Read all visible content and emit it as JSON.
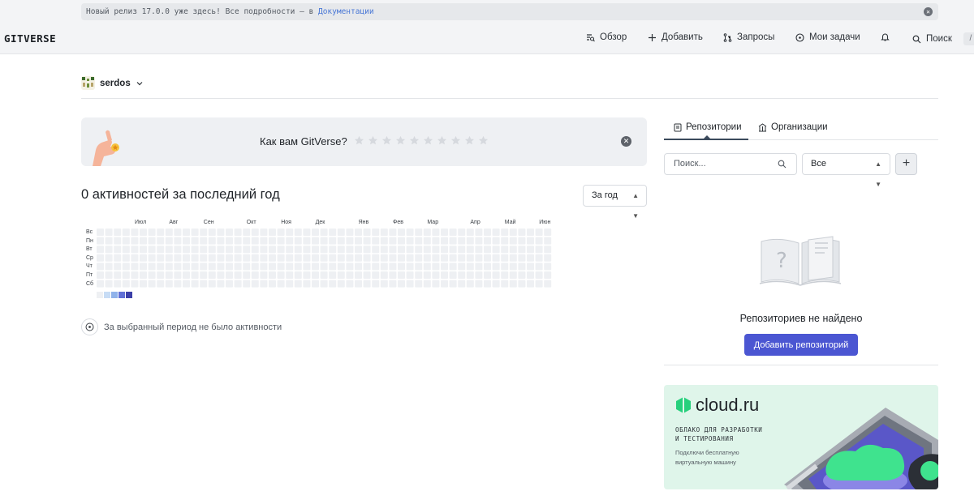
{
  "announcement": {
    "text": "Новый релиз 17.0.0 уже здесь! Все подробности — в ",
    "link": "Документации"
  },
  "header": {
    "logo": "GITVERSE",
    "nav": {
      "overview": "Обзор",
      "add": "Добавить",
      "requests": "Запросы",
      "tasks": "Мои задачи",
      "search": "Поиск",
      "search_shortcut": "/"
    }
  },
  "user": {
    "name": "serdos"
  },
  "feedback": {
    "question": "Как вам GitVerse?",
    "stars": 10
  },
  "activity": {
    "title": "0 активностей за последний год",
    "period": "За год",
    "months": [
      "Июл",
      "Авг",
      "Сен",
      "Окт",
      "Ноя",
      "Дек",
      "Янв",
      "Фев",
      "Мар",
      "Апр",
      "Май",
      "Июн"
    ],
    "days": [
      "Вс",
      "Пн",
      "Вт",
      "Ср",
      "Чт",
      "Пт",
      "Сб"
    ],
    "weeks": 53,
    "legend_colors": [
      "#eef0f3",
      "#c7dcf5",
      "#8fb2ea",
      "#5f6fd6",
      "#3b3fa8"
    ],
    "empty_text": "За выбранный период не было активности"
  },
  "repos": {
    "tabs": [
      "Репозитории",
      "Организации"
    ],
    "search_placeholder": "Поиск...",
    "filter_value": "Все",
    "add_icon": "+",
    "empty_title": "Репозиториев не найдено",
    "add_button": "Добавить репозиторий"
  },
  "ad": {
    "brand": "cloud.ru",
    "headline_1": "Облако для разработки",
    "headline_2": "и тестирования",
    "sub_1": "Подключи бесплатную",
    "sub_2": "виртуальную машину"
  },
  "colors": {
    "accent": "#4b56d2",
    "ad_bg": "#dff5ea",
    "brand_green": "#26d07c"
  }
}
